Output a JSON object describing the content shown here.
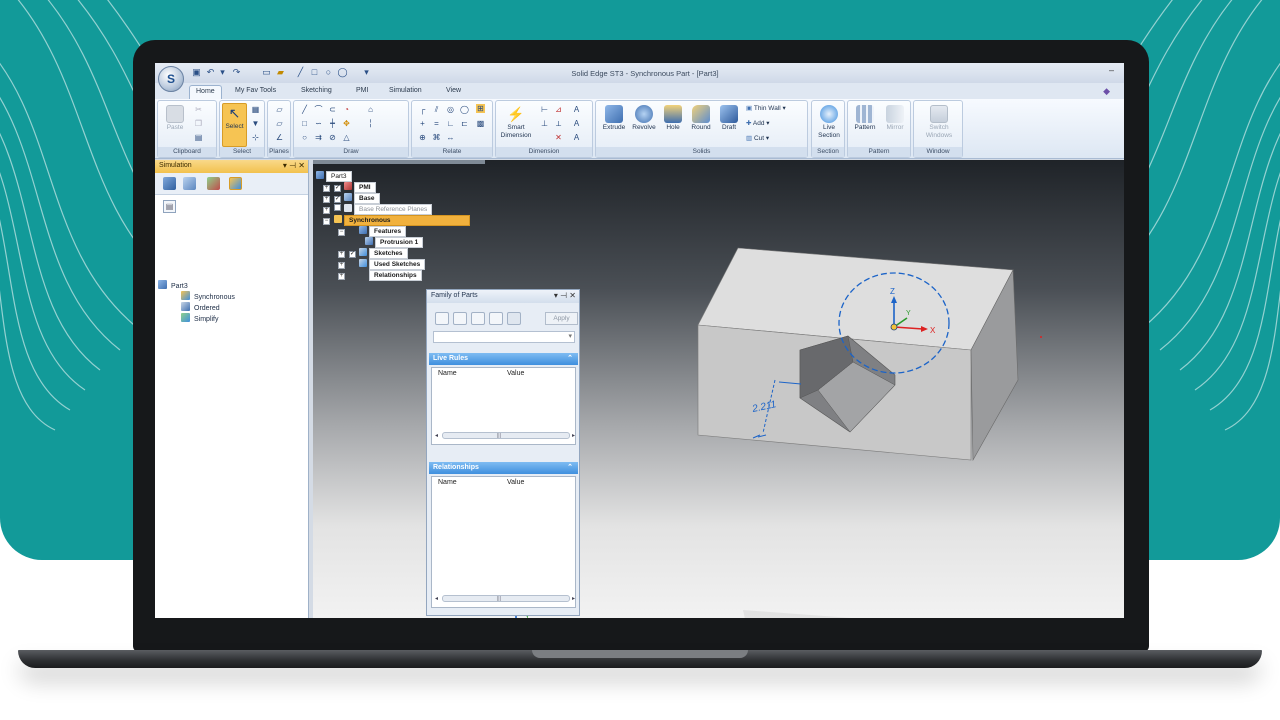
{
  "app": {
    "window_title": "Solid Edge ST3 - Synchronous Part - [Part3]",
    "minimize_glyph": "–",
    "logo_letter": "S"
  },
  "tabs": [
    "Home",
    "My Fav Tools",
    "Sketching",
    "PMI",
    "Simulation",
    "View"
  ],
  "active_tab": "Home",
  "ribbon": {
    "clipboard": {
      "label": "Clipboard",
      "paste": "Paste"
    },
    "select": {
      "label": "Select",
      "select": "Select"
    },
    "planes": {
      "label": "Planes"
    },
    "draw": {
      "label": "Draw"
    },
    "relate": {
      "label": "Relate"
    },
    "dimension": {
      "label": "Dimension",
      "smart_dimension_line1": "Smart",
      "smart_dimension_line2": "Dimension"
    },
    "solids": {
      "label": "Solids",
      "extrude": "Extrude",
      "revolve": "Revolve",
      "hole": "Hole",
      "round": "Round",
      "draft": "Draft",
      "thin_wall": "Thin Wall",
      "add": "Add",
      "cut": "Cut"
    },
    "section": {
      "label": "Section",
      "live_section_line1": "Live",
      "live_section_line2": "Section"
    },
    "pattern": {
      "label": "Pattern",
      "pattern": "Pattern",
      "mirror": "Mirror"
    },
    "window": {
      "label": "Window",
      "switch_windows_line1": "Switch",
      "switch_windows_line2": "Windows"
    }
  },
  "simulation_pane": {
    "title": "Simulation",
    "tree": {
      "root": "Part3",
      "items": [
        "Synchronous",
        "Ordered",
        "Simplify"
      ]
    }
  },
  "pathfinder": {
    "root": "Part3",
    "items": [
      {
        "label": "PMI",
        "expand": "+",
        "checked": true
      },
      {
        "label": "Base",
        "expand": "+",
        "checked": true
      },
      {
        "label": "Base Reference Planes",
        "expand": "+",
        "checked": false
      },
      {
        "label": "Synchronous",
        "expand": "−",
        "selected": true
      },
      {
        "label": "Features",
        "expand": "−"
      },
      {
        "label": "Protrusion 1"
      },
      {
        "label": "Sketches",
        "expand": "+",
        "checked": true
      },
      {
        "label": "Used Sketches",
        "expand": "+"
      },
      {
        "label": "Relationships",
        "expand": "+"
      }
    ]
  },
  "family_of_parts": {
    "title": "Family of Parts",
    "apply": "Apply",
    "live_rules": {
      "title": "Live Rules",
      "columns": [
        "Name",
        "Value"
      ]
    },
    "relationships": {
      "title": "Relationships",
      "columns": [
        "Name",
        "Value"
      ]
    }
  },
  "model": {
    "dimension_value": "2.211",
    "triad_labels": {
      "x": "X",
      "y": "Y",
      "z": "Z"
    }
  },
  "colors": {
    "teal_background": "#129a99",
    "ribbon_select_highlight": "#f6c453",
    "section_bar": "#3f8fde",
    "dimension_blue": "#1c64c8"
  }
}
